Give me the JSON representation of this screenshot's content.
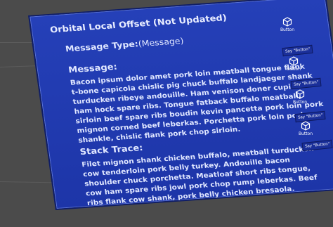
{
  "panel": {
    "title": "Orbital Local Offset (Not Updated)",
    "message_type_label": "Message Type:",
    "message_type_value": "(Message)",
    "message_heading": "Message:",
    "message_lines": [
      "Bacon ipsum dolor amet pork loin meatball tongue flank",
      "t-bone capicola chislic pig chuck buffalo landjaeger shank",
      "turducken ribeye andouille. Ham venison doner cupim",
      "ham hock spare ribs. Tongue fatback buffalo meatball,",
      "sirloin beef spare ribs boudin kevin pancetta pork loin pork",
      "mignon corned beef leberkas. Porchetta pork loin pork",
      "shankle, chislic flank pork chop sirloin."
    ],
    "stack_heading": "Stack Trace:",
    "stack_lines": [
      "Filet mignon shank chicken buffalo, meatball turducken",
      "cow tenderloin pork belly turkey. Andouille bacon",
      "shoulder chuck porchetta. Meatloaf short ribs tongue,",
      "cow ham spare ribs jowl pork chop rump leberkas. Beef",
      "ribs flank cow shank, pork belly chicken bresaola."
    ]
  },
  "side_buttons": [
    {
      "label": "Button"
    },
    {
      "label": "Button"
    },
    {
      "label": "Button"
    },
    {
      "label": "Button"
    }
  ],
  "say_buttons": [
    {
      "label": "Say \"Button\""
    },
    {
      "label": "Say \"Button\""
    },
    {
      "label": "Say \"Button\""
    },
    {
      "label": "Say \"Button\""
    }
  ],
  "colors": {
    "background": "#4b4b4b",
    "panel": "#2540b8",
    "panel_border": "#0f1d66",
    "text": "#dfe6ff"
  },
  "icons": [
    "cube-icon"
  ]
}
